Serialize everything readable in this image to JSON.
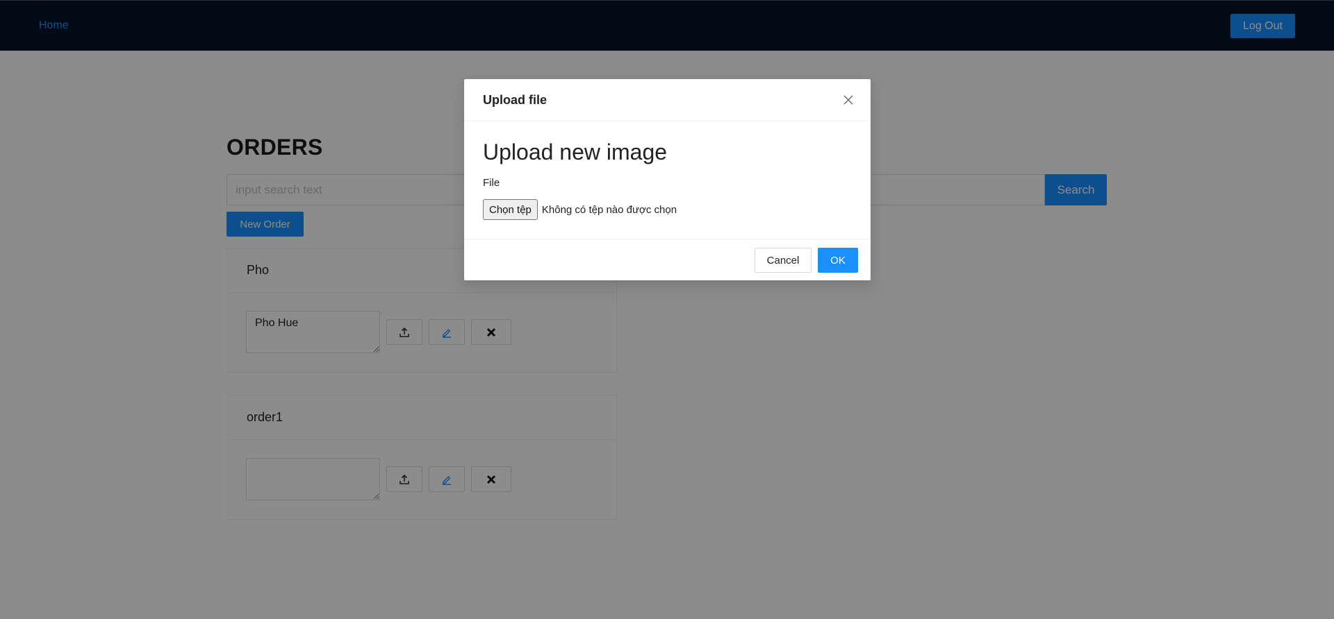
{
  "navbar": {
    "home_label": "Home",
    "logout_label": "Log Out"
  },
  "page": {
    "title": "ORDERS",
    "search_placeholder": "input search text",
    "search_value": "",
    "search_button": "Search",
    "new_order_button": "New Order"
  },
  "orders": [
    {
      "name": "Pho",
      "description": "Pho Hue"
    },
    {
      "name": "order1",
      "description": ""
    }
  ],
  "modal": {
    "title": "Upload file",
    "heading": "Upload new image",
    "file_label": "File",
    "choose_button": "Chọn tệp",
    "no_file_text": "Không có tệp nào được chọn",
    "cancel_button": "Cancel",
    "ok_button": "OK"
  },
  "icons": {
    "card_actions": [
      "upload-icon",
      "edit-icon",
      "delete-icon"
    ],
    "modal_close": "close-icon"
  },
  "colors": {
    "navbar_bg": "#001529",
    "primary": "#1890ff",
    "overlay": "rgba(0,0,0,0.45)"
  }
}
